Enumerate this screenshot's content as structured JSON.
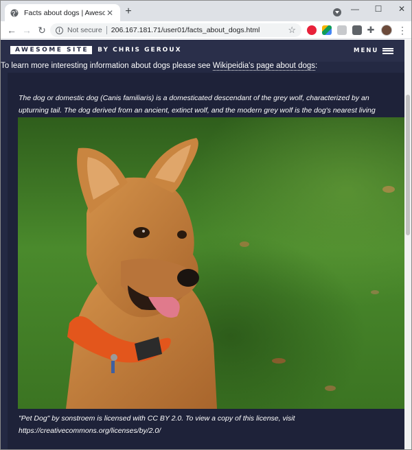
{
  "browser": {
    "tab_title": "Facts about dogs | Awesome Site",
    "tab_close": "✕",
    "new_tab": "+",
    "security_label": "Not secure",
    "url": "206.167.181.71/user01/facts_about_dogs.html",
    "icons": {
      "globe": "globe-icon",
      "back": "back-arrow-icon",
      "forward": "forward-arrow-icon",
      "reload": "reload-icon",
      "info": "info-icon",
      "star": "star-icon",
      "menu": "kebab-menu-icon"
    }
  },
  "site": {
    "logo_text": "AWESOME SITE",
    "byline": "BY CHRIS GEROUX",
    "menu_label": "MENU"
  },
  "page": {
    "intro_text": "To learn more interesting information about dogs please see ",
    "intro_link": "Wikipeidia's page about dogs",
    "intro_end": ":",
    "caption": "The dog or domestic dog (Canis familiaris) is a domesticated descendant of the grey wolf, characterized by an upturning tail. The dog derived from an ancient, extinct wolf, and the modern grey wolf is the dog's nearest living relative.",
    "license": "\"Pet Dog\" by sonstroem is licensed with CC BY 2.0. To view a copy of this license, visit https://creativecommons.org/licenses/by/2.0/"
  },
  "colors": {
    "page_bg": "#242943",
    "header_bg": "#2a2f4a",
    "content_bg": "#1e2239",
    "grass": "#3d7a25",
    "dog": "#c07a3a",
    "collar": "#e3561c"
  }
}
